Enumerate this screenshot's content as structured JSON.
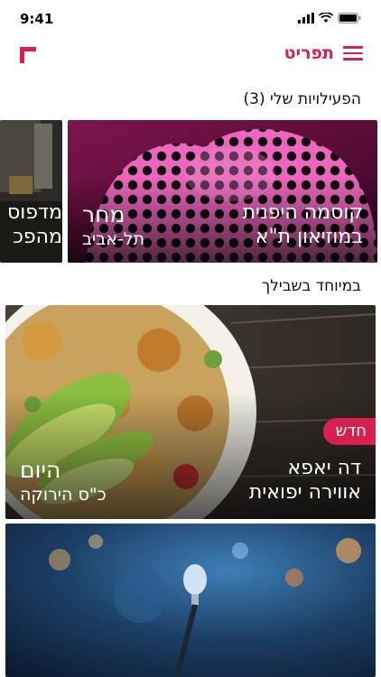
{
  "status": {
    "time": "9:41"
  },
  "nav": {
    "menu_label": "תפריט",
    "logo_icon": "corner-logo-icon",
    "menu_icon": "hamburger-icon"
  },
  "sections": {
    "my_activities": "הפעילויות שלי (3)",
    "for_you": "במיוחד בשבילך"
  },
  "activities": [
    {
      "title": "קוסמה היפנית",
      "subtitle": "במוזיאון ת\"א",
      "date": "מחר",
      "place": "תל-אביב"
    },
    {
      "title": "מדפוס",
      "subtitle": "מהפכ"
    }
  ],
  "featured": [
    {
      "badge": "חדש",
      "title": "דה יאפא",
      "subtitle": "אווירה יפואית",
      "date": "היום",
      "place": "כ\"ס הירוקה"
    },
    {
      "title": "",
      "subtitle": ""
    }
  ],
  "colors": {
    "accent": "#d8204f"
  }
}
